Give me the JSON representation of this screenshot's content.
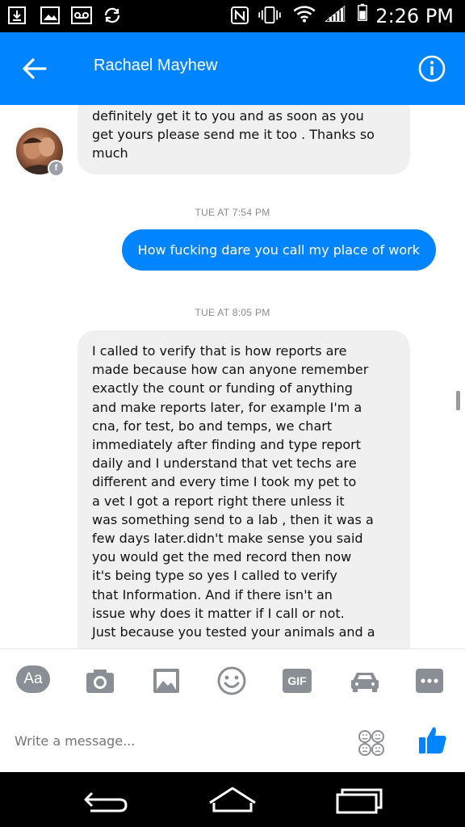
{
  "status_bar": {
    "time": "2:26 PM"
  },
  "header": {
    "contact_name": "Rachael Mayhew"
  },
  "messages": [
    {
      "type": "incoming",
      "lines": [
        "definitely get it to you and as soon as you",
        "get yours please send me it too . Thanks so",
        "much"
      ]
    },
    {
      "type": "timestamp",
      "text": "TUE AT 7:54 PM"
    },
    {
      "type": "outgoing",
      "text": "How fucking dare you call my place of work"
    },
    {
      "type": "timestamp",
      "text": "TUE AT 8:05 PM"
    },
    {
      "type": "incoming",
      "lines": [
        "I called to verify that is how reports are",
        "made because how can anyone remember",
        "exactly the count or funding of anything",
        "and make reports later, for example I'm a",
        "cna, for test, bo and temps, we chart",
        "immediately after finding and type  report",
        "daily and I understand that vet techs are",
        "different and every time I took my pet to",
        "a vet I got a report right there unless it",
        "was something send to a lab , then it was a",
        "few days later.didn't make sense you said",
        "you would get the med record then now",
        "it's being type so yes I called to verify",
        "that Information.  And if there isn't an",
        "issue why does it matter if I call or not.",
        "Just because you tested your animals and a"
      ]
    }
  ],
  "toolbar": {
    "aa_label": "Aa",
    "gif_label": "GIF",
    "icons": [
      "aa-icon",
      "camera-icon",
      "gallery-icon",
      "emoji-icon",
      "gif-icon",
      "car-icon",
      "more-icon"
    ]
  },
  "composer": {
    "placeholder": "Write a message..."
  },
  "colors": {
    "accent": "#0084ff",
    "bubble_incoming": "#f1f0f0",
    "toolbar_icon": "#8a8f96"
  }
}
